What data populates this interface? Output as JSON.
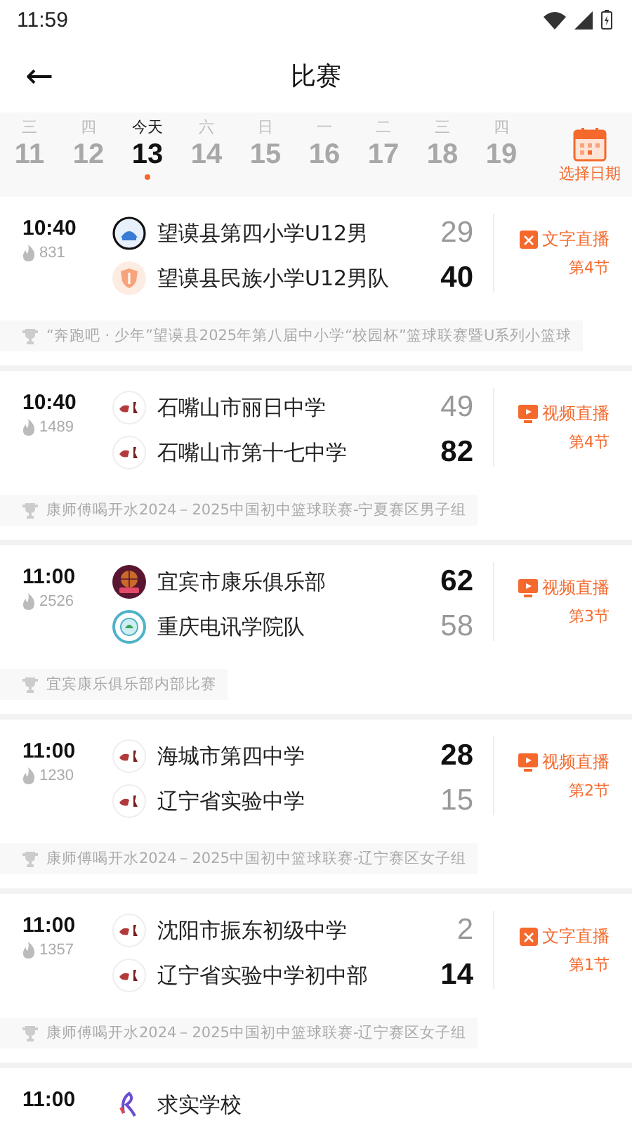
{
  "status_bar": {
    "time": "11:59"
  },
  "header": {
    "back": "←",
    "title": "比赛"
  },
  "dates": [
    {
      "weekday": "三",
      "day": "11",
      "selected": false
    },
    {
      "weekday": "四",
      "day": "12",
      "selected": false
    },
    {
      "weekday": "今天",
      "day": "13",
      "selected": true
    },
    {
      "weekday": "六",
      "day": "14",
      "selected": false
    },
    {
      "weekday": "日",
      "day": "15",
      "selected": false
    },
    {
      "weekday": "一",
      "day": "16",
      "selected": false
    },
    {
      "weekday": "二",
      "day": "17",
      "selected": false
    },
    {
      "weekday": "三",
      "day": "18",
      "selected": false
    },
    {
      "weekday": "四",
      "day": "19",
      "selected": false
    }
  ],
  "date_picker": {
    "label": "选择日期"
  },
  "matches": [
    {
      "time": "10:40",
      "heat": "831",
      "teams": [
        {
          "name": "望谟县第四小学U12男",
          "score": "29",
          "leading": false,
          "kind": "emblem"
        },
        {
          "name": "望谟县民族小学U12男队",
          "score": "40",
          "leading": true,
          "kind": "shield"
        }
      ],
      "broadcast": {
        "kind": "text",
        "label": "文字直播",
        "period": "第4节"
      },
      "league": "“奔跑吧 · 少年”望谟县2025年第八届中小学“校园杯”篮球联赛暨U系列小篮球"
    },
    {
      "time": "10:40",
      "heat": "1489",
      "teams": [
        {
          "name": "石嘴山市丽日中学",
          "score": "49",
          "leading": false,
          "kind": "mascot"
        },
        {
          "name": "石嘴山市第十七中学",
          "score": "82",
          "leading": true,
          "kind": "mascot"
        }
      ],
      "broadcast": {
        "kind": "video",
        "label": "视频直播",
        "period": "第4节"
      },
      "league": "康师傅喝开水2024－2025中国初中篮球联赛-宁夏赛区男子组"
    },
    {
      "time": "11:00",
      "heat": "2526",
      "teams": [
        {
          "name": "宜宾市康乐俱乐部",
          "score": "62",
          "leading": true,
          "kind": "ball"
        },
        {
          "name": "重庆电讯学院队",
          "score": "58",
          "leading": false,
          "kind": "seal"
        }
      ],
      "broadcast": {
        "kind": "video",
        "label": "视频直播",
        "period": "第3节"
      },
      "league": "宜宾康乐俱乐部内部比赛"
    },
    {
      "time": "11:00",
      "heat": "1230",
      "teams": [
        {
          "name": "海城市第四中学",
          "score": "28",
          "leading": true,
          "kind": "mascot"
        },
        {
          "name": "辽宁省实验中学",
          "score": "15",
          "leading": false,
          "kind": "mascot"
        }
      ],
      "broadcast": {
        "kind": "video",
        "label": "视频直播",
        "period": "第2节"
      },
      "league": "康师傅喝开水2024－2025中国初中篮球联赛-辽宁赛区女子组"
    },
    {
      "time": "11:00",
      "heat": "1357",
      "teams": [
        {
          "name": "沈阳市振东初级中学",
          "score": "2",
          "leading": false,
          "kind": "mascot"
        },
        {
          "name": "辽宁省实验中学初中部",
          "score": "14",
          "leading": true,
          "kind": "mascot"
        }
      ],
      "broadcast": {
        "kind": "text",
        "label": "文字直播",
        "period": "第1节"
      },
      "league": "康师傅喝开水2024－2025中国初中篮球联赛-辽宁赛区女子组"
    },
    {
      "time": "11:00",
      "teams": [
        {
          "name": "求实学校",
          "kind": "ribbon"
        }
      ]
    }
  ]
}
